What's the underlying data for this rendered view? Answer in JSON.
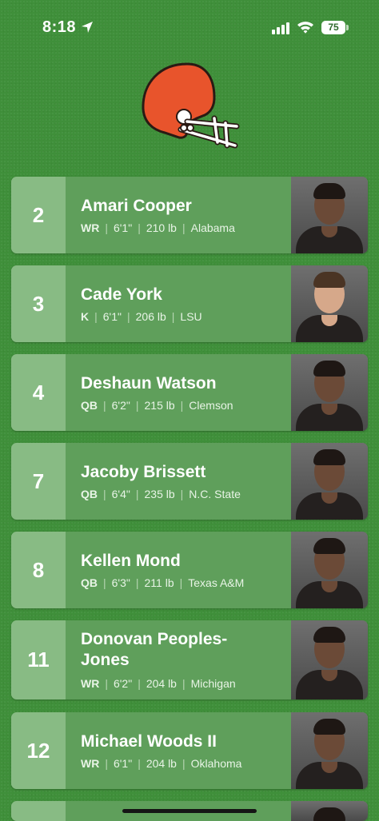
{
  "status_bar": {
    "time": "8:18",
    "battery": "75"
  },
  "roster": [
    {
      "number": "2",
      "name": "Amari Cooper",
      "position": "WR",
      "height": "6'1\"",
      "weight": "210 lb",
      "college": "Alabama"
    },
    {
      "number": "3",
      "name": "Cade York",
      "position": "K",
      "height": "6'1\"",
      "weight": "206 lb",
      "college": "LSU"
    },
    {
      "number": "4",
      "name": "Deshaun Watson",
      "position": "QB",
      "height": "6'2\"",
      "weight": "215 lb",
      "college": "Clemson"
    },
    {
      "number": "7",
      "name": "Jacoby Brissett",
      "position": "QB",
      "height": "6'4\"",
      "weight": "235 lb",
      "college": "N.C. State"
    },
    {
      "number": "8",
      "name": "Kellen Mond",
      "position": "QB",
      "height": "6'3\"",
      "weight": "211 lb",
      "college": "Texas A&M"
    },
    {
      "number": "11",
      "name": "Donovan Peoples-Jones",
      "position": "WR",
      "height": "6'2\"",
      "weight": "204 lb",
      "college": "Michigan"
    },
    {
      "number": "12",
      "name": "Michael Woods II",
      "position": "WR",
      "height": "6'1\"",
      "weight": "204 lb",
      "college": "Oklahoma"
    }
  ],
  "colors": {
    "background": "#3f8f3a",
    "card": "#5f9f5b",
    "number_panel": "#88bb84",
    "helmet": "#e8542c"
  },
  "icons": {
    "logo": "football-helmet-icon",
    "location": "location-arrow-icon",
    "signal": "cellular-signal-icon",
    "wifi": "wifi-icon",
    "battery": "battery-icon"
  }
}
